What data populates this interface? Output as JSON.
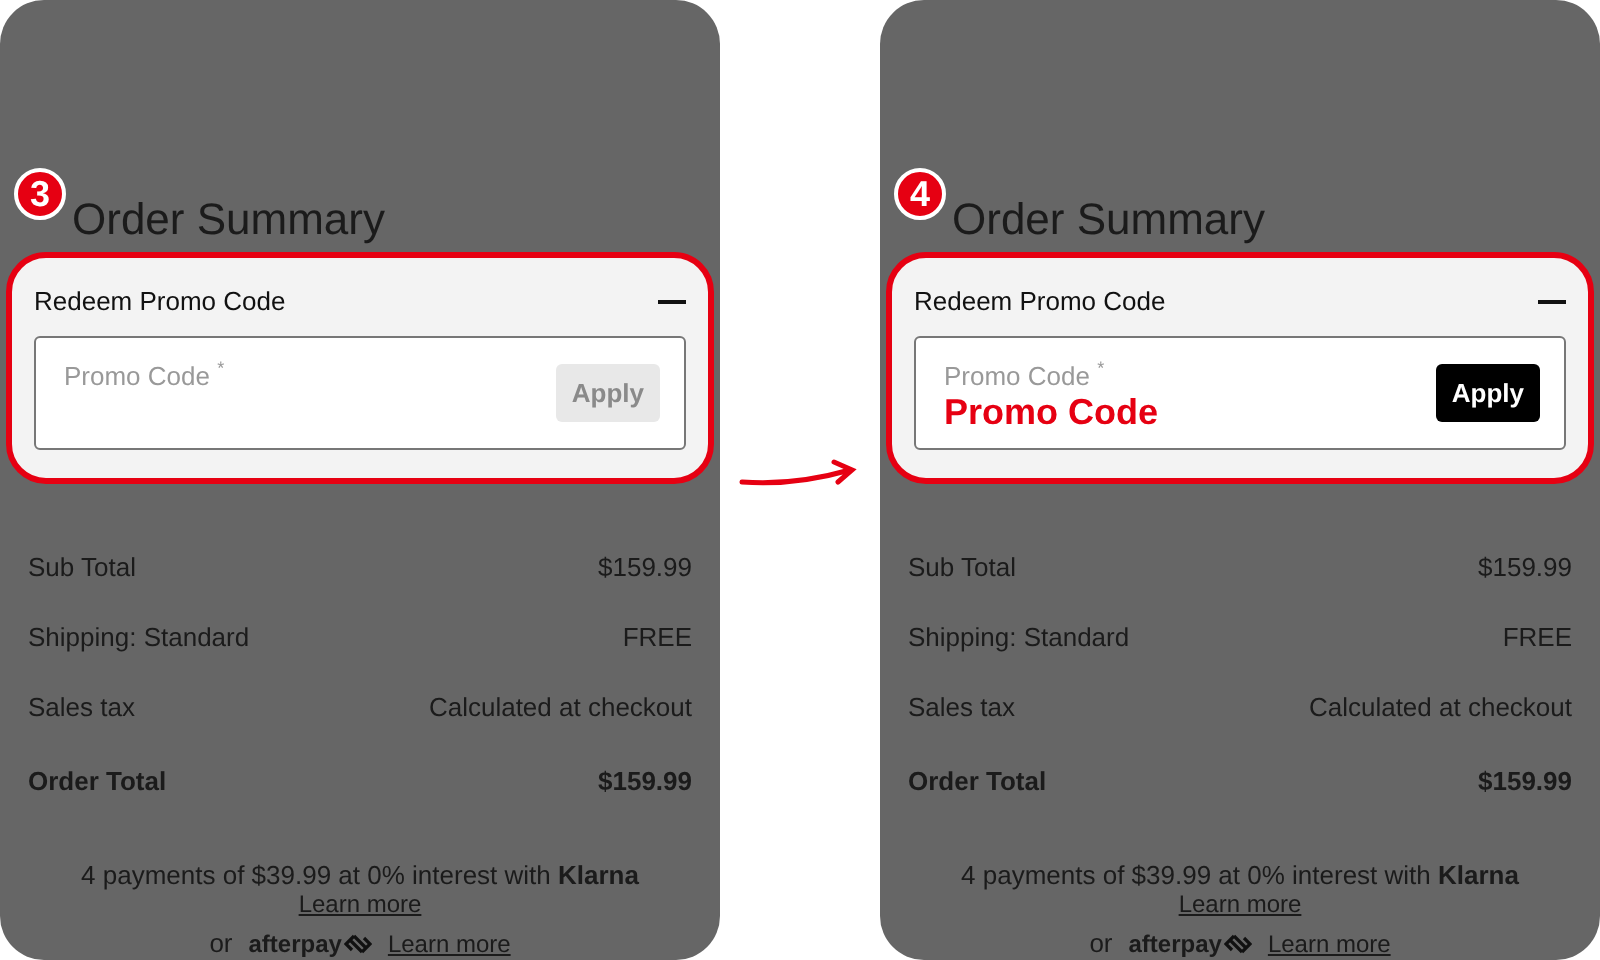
{
  "panels": [
    {
      "step": "3",
      "title": "Order Summary",
      "promo": {
        "heading": "Redeem Promo Code",
        "expanded": true,
        "label": "Promo Code",
        "required_mark": "*",
        "apply": {
          "label": "Apply",
          "disabled": true
        }
      },
      "rows": [
        {
          "label": "Sub Total",
          "value": "$159.99",
          "kind": "line"
        },
        {
          "label": "Shipping: Standard",
          "value": "FREE",
          "kind": "line"
        },
        {
          "label": "Sales tax",
          "value": "Calculated at checkout",
          "kind": "line"
        },
        {
          "label": "Order Total",
          "value": "$159.99",
          "kind": "total"
        }
      ],
      "klarna": {
        "text": "4 payments of $39.99 at 0% interest with **Klarna**",
        "link": "Learn more"
      },
      "afterpay": {
        "prefix": "or",
        "logo": "afterpay",
        "link": "Learn more"
      }
    },
    {
      "step": "4",
      "title": "Order Summary",
      "promo": {
        "heading": "Redeem Promo Code",
        "expanded": true,
        "label": "Promo Code",
        "required_mark": "*",
        "value": "Promo Code",
        "apply": {
          "label": "Apply",
          "disabled": false
        }
      },
      "rows": [
        {
          "label": "Sub Total",
          "value": "$159.99",
          "kind": "line"
        },
        {
          "label": "Shipping: Standard",
          "value": "FREE",
          "kind": "line"
        },
        {
          "label": "Sales tax",
          "value": "Calculated at checkout",
          "kind": "line"
        },
        {
          "label": "Order Total",
          "value": "$159.99",
          "kind": "total"
        }
      ],
      "klarna": {
        "text": "4 payments of $39.99 at 0% interest with **Klarna**",
        "link": "Learn more"
      },
      "afterpay": {
        "prefix": "or",
        "logo": "afterpay",
        "link": "Learn more"
      }
    }
  ]
}
